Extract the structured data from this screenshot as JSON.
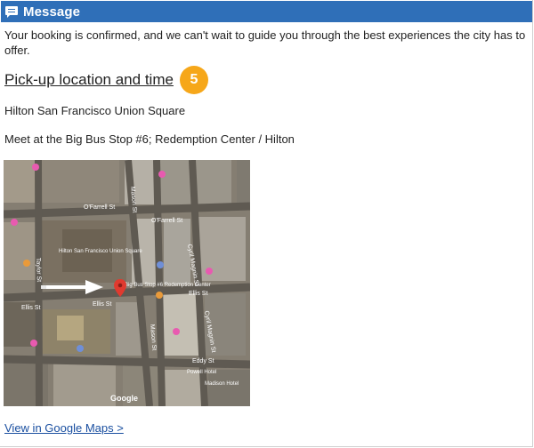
{
  "header": {
    "title": "Message",
    "icon": "message-icon",
    "bg_color": "#2f6fb8"
  },
  "intro_text": "Your booking is confirmed, and we can't wait to guide you through the best experiences the city has to offer.",
  "pickup": {
    "title": "Pick-up location and time",
    "badge": "5",
    "badge_color": "#f6a71a"
  },
  "hotel": "Hilton San Francisco Union Square",
  "meeting_point": "Meet at the Big Bus Stop #6; Redemption Center / Hilton",
  "map": {
    "streets": [
      "O'Farrell St",
      "O'Farrell St",
      "Ellis St",
      "Ellis St",
      "Ellis St",
      "Eddy St",
      "Mason St",
      "Mason St",
      "Cyril Magnin St",
      "Cyril Magnin St",
      "Taylor St"
    ],
    "places": [
      "Hilton San Francisco Union Square",
      "Big Bus Stop #6 Redemption Center",
      "Madison Hotel",
      "Powell Hotel"
    ],
    "attribution": "Google",
    "pin_color": "#e03a2f",
    "arrow_color": "#ffffff"
  },
  "link": {
    "label": "View in Google Maps >"
  }
}
